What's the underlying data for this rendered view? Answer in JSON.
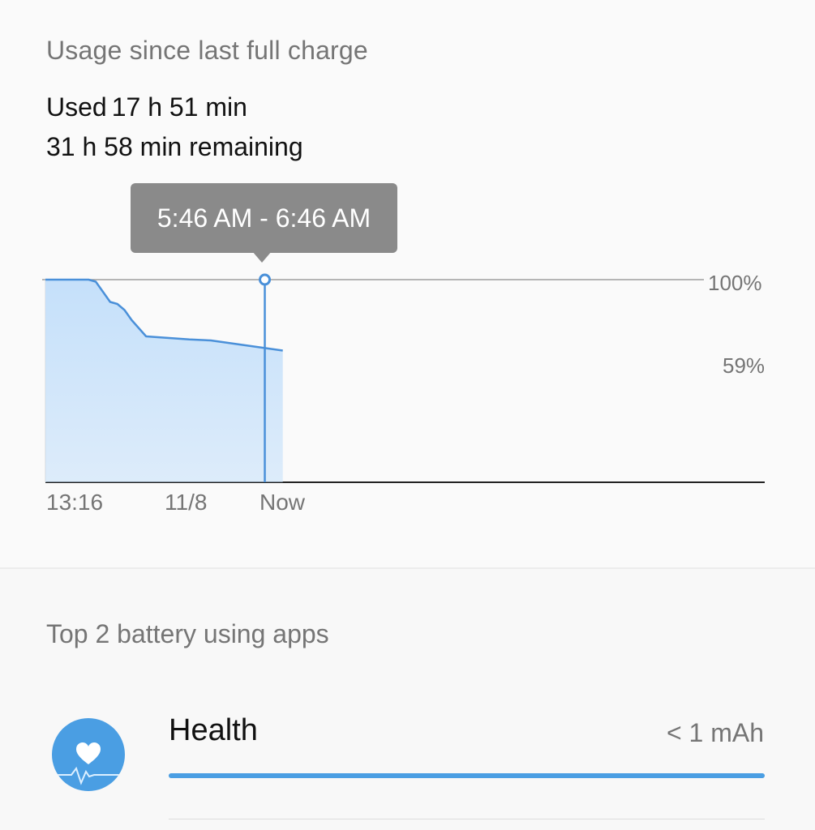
{
  "usage_section": {
    "title": "Usage since last full charge",
    "used_label": "Used",
    "used_value": "17 h 51 min",
    "remaining": "31 h 58 min remaining"
  },
  "tooltip": {
    "text": "5:46 AM - 6:46 AM"
  },
  "chart_data": {
    "type": "area",
    "y_unit": "%",
    "ylim": [
      0,
      100
    ],
    "y_tick_labels": [
      "100%",
      "59%"
    ],
    "x_tick_labels": [
      "13:16",
      "11/8",
      "Now"
    ],
    "x": [
      0,
      0.06,
      0.07,
      0.08,
      0.09,
      0.1,
      0.11,
      0.12,
      0.13,
      0.14,
      0.18,
      0.2,
      0.23,
      0.26,
      0.3,
      0.33
    ],
    "values": [
      100,
      100,
      99,
      94,
      89,
      88,
      85,
      80,
      76,
      72,
      71,
      70.5,
      70,
      68.5,
      66.5,
      65
    ],
    "selected_x": 0.305,
    "colors": {
      "line": "#4a90d9",
      "fill": "#c5e0fa"
    }
  },
  "apps_section": {
    "title": "Top 2 battery using apps",
    "apps": [
      {
        "name": "Health",
        "usage": "< 1 mAh",
        "usage_fraction": 1.0,
        "icon": "heart-pulse-icon"
      }
    ]
  }
}
